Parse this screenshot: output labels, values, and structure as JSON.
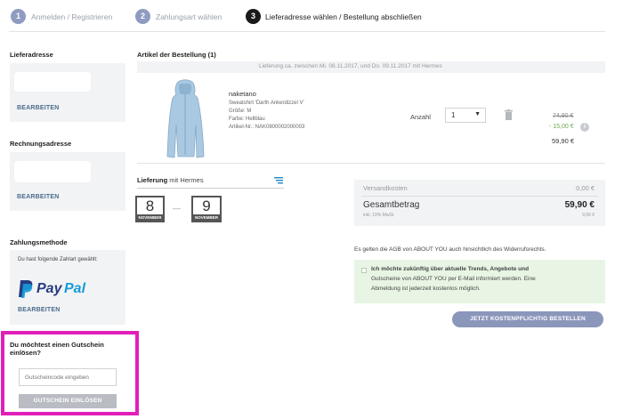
{
  "steps": [
    {
      "number": "1",
      "label": "Anmelden / Registrieren"
    },
    {
      "number": "2",
      "label": "Zahlungsart wählen"
    },
    {
      "number": "3",
      "label": "Lieferadresse wählen / Bestellung abschließen"
    }
  ],
  "sidebar": {
    "delivery_title": "Lieferadresse",
    "billing_title": "Rechnungsadresse",
    "payment_title": "Zahlungsmethode",
    "edit_label": "BEARBEITEN",
    "payment_text": "Du hast folgende Zahlart gewählt:",
    "paypal_pay": "Pay",
    "paypal_pal": "Pal",
    "coupon_title": "Du möchtest einen Gutschein einlösen?",
    "coupon_placeholder": "Gutscheincode eingeben",
    "coupon_button": "GUTSCHEIN EINLÖSEN"
  },
  "order": {
    "title": "Artikel der Bestellung (1)",
    "delivery_window": "Lieferung ca. zwischen Mi. 08.11.2017, und Do. 09.11.2017 mit Hermes",
    "item": {
      "brand": "naketano",
      "name": "Sweatshirt 'Darth Ankerdizzel V'",
      "size": "Größe: M",
      "color": "Farbe: Hellblau",
      "article_no": "Artikel-Nr.: NAK0800002000003",
      "qty_label": "Anzahl",
      "qty_value": "1",
      "old_price": "74,90 €",
      "discount": "- 15,00 €",
      "price": "59,90 €"
    }
  },
  "shipping": {
    "label_prefix": "Lieferung",
    "label_carrier": "mit Hermes",
    "day_from": "8",
    "month_from": "NOVEMBER",
    "dash": "—",
    "day_to": "9",
    "month_to": "NOVEMBER"
  },
  "totals": {
    "shipping_label": "Versandkosten",
    "shipping_value": "0,00 €",
    "total_label": "Gesamtbetrag",
    "total_value": "59,90 €",
    "vat_label": "inkl. 19% MwSt.",
    "vat_value": "9,56 €"
  },
  "terms_text": "Es gelten die AGB von ABOUT YOU auch hinsichtlich des Widerrufsrechts.",
  "newsletter": {
    "p1": "Ich möchte zukünftig über aktuelle Trends, Angebote und",
    "p2": "Gutscheine von ABOUT YOU per E-Mail informiert werden. Eine",
    "p3": "Abmeldung ist jederzeit kostenlos möglich."
  },
  "order_button": "JETZT KOSTENPFLICHTIG BESTELLEN",
  "colors": {
    "step_inactive": "#8f9bc0",
    "step_active": "#1a1a1a",
    "highlight_border": "#e21fb8",
    "paypal_dark": "#253b80",
    "paypal_light": "#179bd7",
    "discount_green": "#6aa84f",
    "newsletter_bg": "#e8f5e4"
  }
}
